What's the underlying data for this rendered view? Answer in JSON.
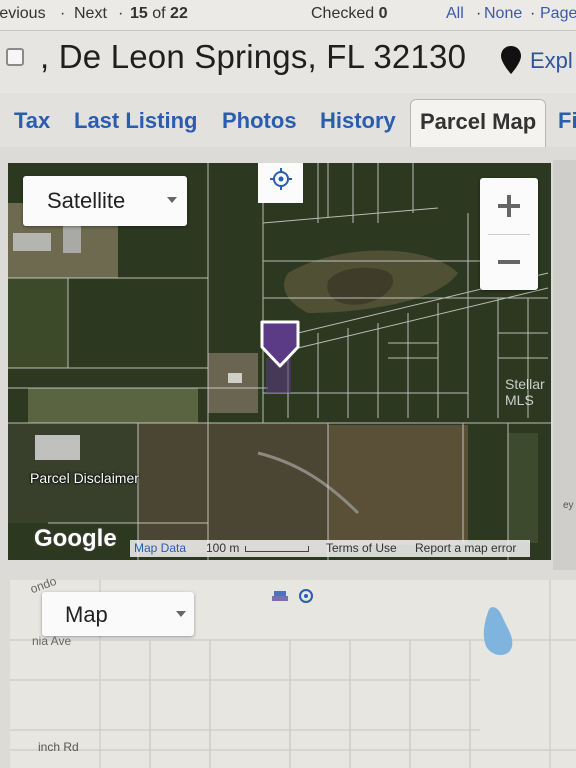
{
  "nav": {
    "prev": "revious",
    "next": "Next",
    "count_pre": "15",
    "count_of": "of",
    "count_total": "22",
    "checked_label": "Checked",
    "checked_value": "0",
    "all": "All",
    "none": "None",
    "page": "Page"
  },
  "header": {
    "address": ", De Leon Springs, FL 32130",
    "explore": "Expl"
  },
  "tabs": [
    {
      "label": "Tax"
    },
    {
      "label": "Last Listing"
    },
    {
      "label": "Photos"
    },
    {
      "label": "History"
    },
    {
      "label": "Parcel Map"
    },
    {
      "label": "Fi"
    }
  ],
  "satellite_map": {
    "map_type": "Satellite",
    "zoom_in": "+",
    "zoom_out": "−",
    "disclaimer": "Parcel Disclaimer",
    "watermark": "Stellar MLS",
    "logo": "Google",
    "map_data": "Map Data",
    "scale": "100 m",
    "terms": "Terms of Use",
    "report": "Report a map error"
  },
  "street_map": {
    "map_type": "Map",
    "road1": "ondo",
    "road2": "nia Ave",
    "road3": "inch Rd"
  },
  "colors": {
    "link": "#2a5db0",
    "marker": "#5b3a86"
  }
}
